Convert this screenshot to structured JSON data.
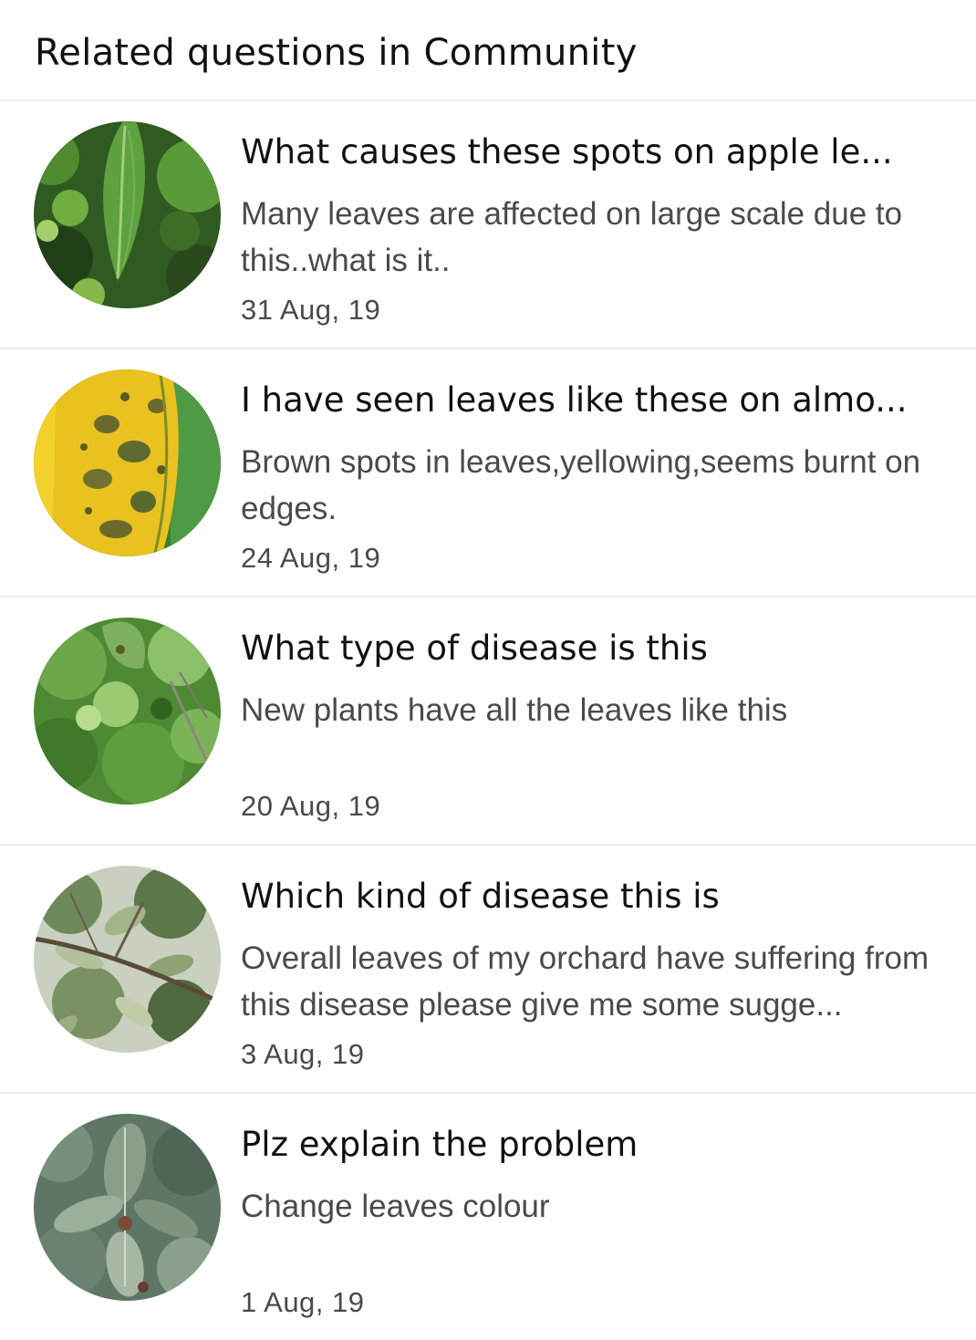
{
  "section": {
    "title": "Related questions in Community"
  },
  "questions": [
    {
      "title": "What causes these spots on apple le...",
      "description": "Many leaves are affected on large scale due to this..what is it..",
      "date": "31 Aug, 19",
      "thumbnail_icon": "green-apple-leaf-photo"
    },
    {
      "title": "I have seen leaves like these on almo...",
      "description": "Brown spots in leaves,yellowing,seems burnt on edges.",
      "date": "24 Aug, 19",
      "thumbnail_icon": "yellow-spotted-leaf-photo"
    },
    {
      "title": "What type of disease is this",
      "description": "New plants have all the leaves like this",
      "date": "20 Aug, 19",
      "thumbnail_icon": "green-plant-foliage-photo"
    },
    {
      "title": "Which kind of disease this is",
      "description": "Overall leaves of my orchard have suffering from this disease please give me some sugge...",
      "date": "3 Aug, 19",
      "thumbnail_icon": "orchard-branch-photo"
    },
    {
      "title": "Plz explain the problem",
      "description": "Change leaves colour",
      "date": "1 Aug, 19",
      "thumbnail_icon": "dusty-leaves-photo"
    }
  ],
  "colors": {
    "title_text": "#111111",
    "secondary_text": "#4a4a4a",
    "divider": "#ececec",
    "background": "#ffffff"
  }
}
